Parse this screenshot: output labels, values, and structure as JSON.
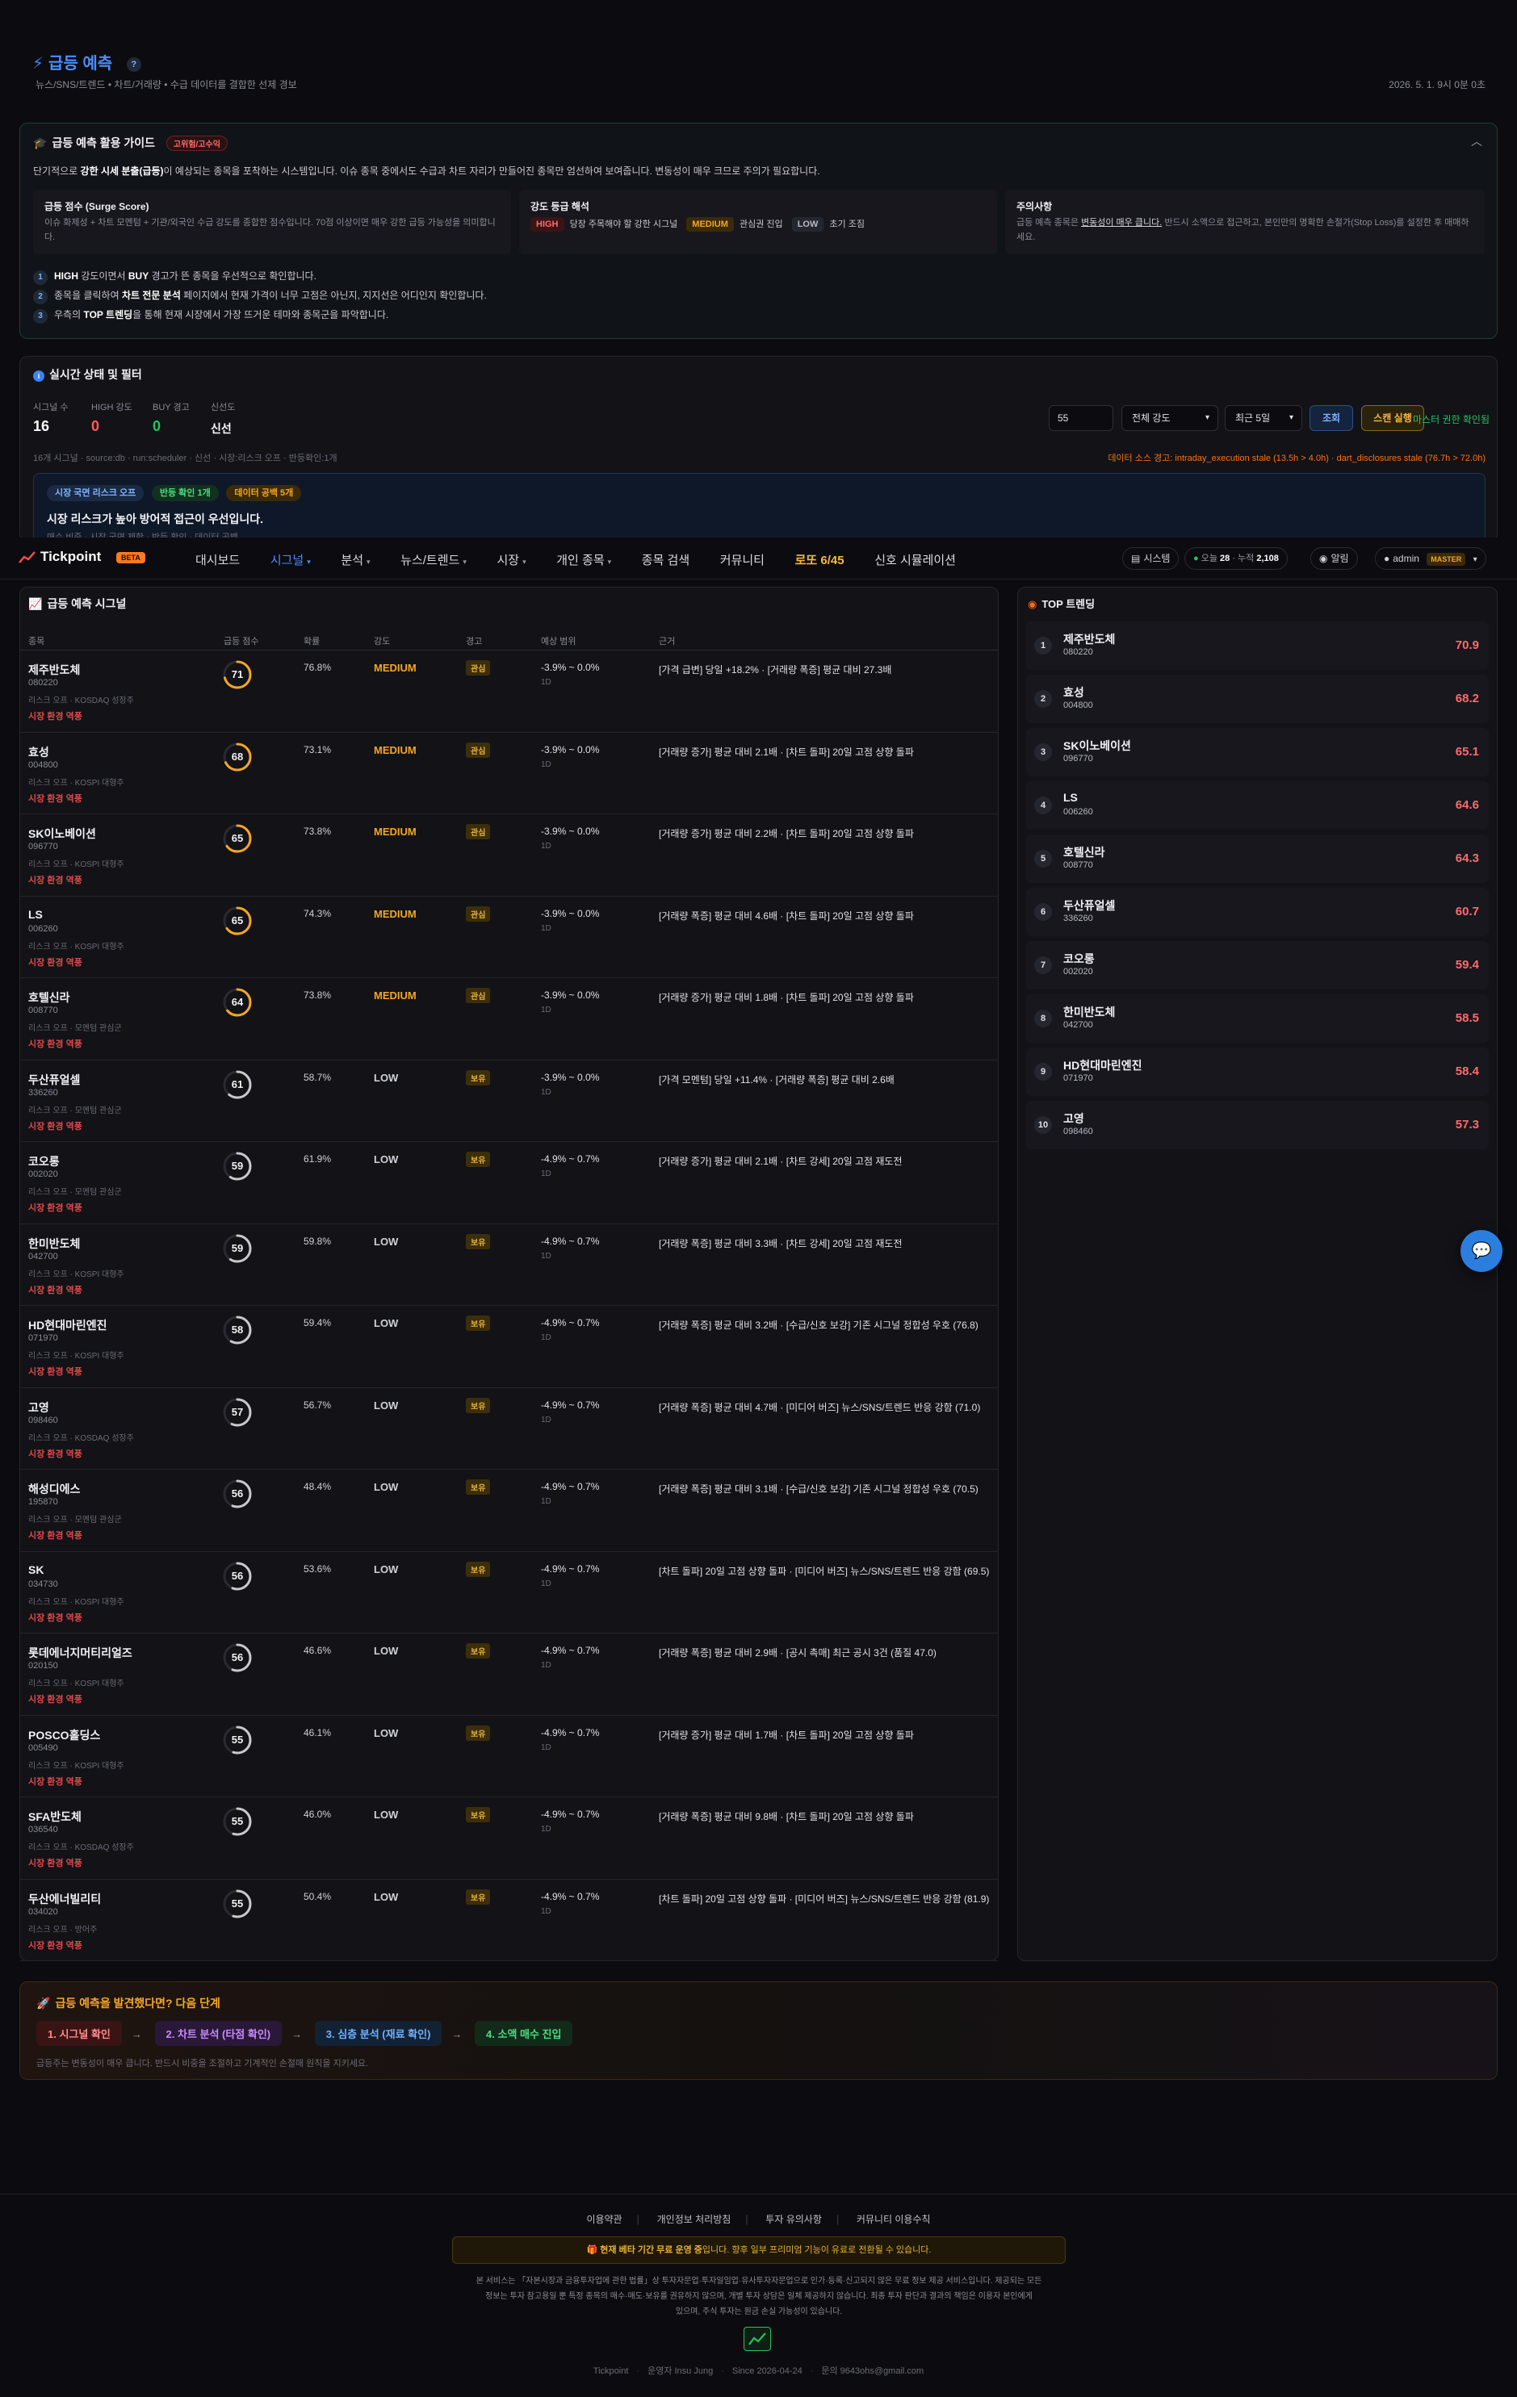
{
  "header": {
    "title": "급등 예측",
    "subtitle": "뉴스/SNS/트렌드 • 차트/거래량 • 수급 데이터를 결합한 선제 경보",
    "datetime": "2026. 5. 1. 9시 0분 0초"
  },
  "guide": {
    "title": "급등 예측 활용 가이드",
    "badge": "고위험/고수익",
    "intro_prefix": "단기적으로 ",
    "intro_bold": "강한 시세 분출(급등)",
    "intro_suffix": "이 예상되는 종목을 포착하는 시스템입니다. 이슈 종목 중에서도 수급과 차트 자리가 만들어진 종목만 엄선하여 보여줍니다. 변동성이 매우 크므로 주의가 필요합니다.",
    "box1_title": "급등 점수 (Surge Score)",
    "box1_text": "이슈 화제성 + 차트 모멘텀 + 기관/외국인 수급 강도를 종합한 점수입니다. 70점 이상이면 매우 강한 급등 가능성을 의미합니다.",
    "box2_title": "강도 등급 해석",
    "box2_high": "HIGH",
    "box2_high_text": "당장 주목해야 할 강한 시그널",
    "box2_med": "MEDIUM",
    "box2_med_text": "관심권 진입",
    "box2_low": "LOW",
    "box2_low_text": "초기 조짐",
    "box3_title": "주의사항",
    "box3_text1": "급등 예측 종목은 ",
    "box3_underline": "변동성이 매우 큽니다.",
    "box3_text2": " 반드시 소액으로 접근하고, 본인만의 명확한 손절가(Stop Loss)를 설정한 후 매매하세요.",
    "tip1_bold1": "HIGH",
    "tip1_mid": " 강도이면서 ",
    "tip1_bold2": "BUY",
    "tip1_end": " 경고가 뜬 종목을 우선적으로 확인합니다.",
    "tip2_start": "종목을 클릭하여 ",
    "tip2_bold": "차트 전문 분석",
    "tip2_end": " 페이지에서 현재 가격이 너무 고점은 아닌지, 지지선은 어디인지 확인합니다.",
    "tip3_start": "우측의 ",
    "tip3_bold": "TOP 트렌딩",
    "tip3_end": "을 통해 현재 시장에서 가장 뜨거운 테마와 종목군을 파악합니다."
  },
  "status": {
    "title": "실시간 상태 및 필터",
    "signal_label": "시그널 수",
    "signal_value": "16",
    "high_label": "HIGH 강도",
    "high_value": "0",
    "buy_label": "BUY 경고",
    "buy_value": "0",
    "fresh_label": "신선도",
    "fresh_value": "신선",
    "meta": "16개 시그널 · source:db · run:scheduler · 신선 · 시장:리스크 오프 · 반등확인:1개",
    "alert": "데이터 소스 경고: intraday_execution stale (13.5h > 4.0h) · dart_disclosures stale (76.7h > 72.0h)",
    "input_value": "55",
    "select_strength": "전체 강도",
    "select_period": "최근 5일",
    "btn_query": "조회",
    "btn_scan": "스캔 실행",
    "master_text": "마스터 권한 확인됨",
    "chip1": "시장 국면 리스크 오프",
    "chip2": "반등 확인 1개",
    "chip3": "데이터 공백 5개",
    "banner_title": "시장 리스크가 높아 방어적 접근이 우선입니다.",
    "banner_sub": "매수 비중 · 시장 국면 제한 · 반등 확인 · 데이터 공백"
  },
  "nav": {
    "logo": "Tickpoint",
    "beta": "BETA",
    "items": [
      "대시보드",
      "시그널",
      "분석",
      "뉴스/트렌드",
      "시장",
      "개인 종목",
      "종목 검색",
      "커뮤니티",
      "로또 6/45",
      "신호 시뮬레이션"
    ],
    "system": "시스템",
    "today_label": "오늘",
    "today_value": "28",
    "total_label": "누적",
    "total_value": "2,108",
    "alarm": "알림",
    "user": "admin",
    "user_role": "MASTER"
  },
  "table": {
    "title": "급등 예측 시그널",
    "headers": [
      "종목",
      "급등 점수",
      "확률",
      "강도",
      "경고",
      "예상 범위",
      "근거"
    ],
    "rows": [
      {
        "name": "제주반도체",
        "code": "080220",
        "risk": "리스크 오프 · KOSDAQ 성장주",
        "env": "시장 환경 역풍",
        "score": 71,
        "prob": "76.8%",
        "strength": "MEDIUM",
        "warn": "관심",
        "range": "-3.9% ~ 0.0%",
        "period": "1D",
        "reason": "[가격 급변] 당일 +18.2% · [거래량 폭증] 평균 대비 27.3배"
      },
      {
        "name": "효성",
        "code": "004800",
        "risk": "리스크 오프 · KOSPI 대형주",
        "env": "시장 환경 역풍",
        "score": 68,
        "prob": "73.1%",
        "strength": "MEDIUM",
        "warn": "관심",
        "range": "-3.9% ~ 0.0%",
        "period": "1D",
        "reason": "[거래량 증가] 평균 대비 2.1배 · [차트 돌파] 20일 고점 상향 돌파"
      },
      {
        "name": "SK이노베이션",
        "code": "096770",
        "risk": "리스크 오프 · KOSPI 대형주",
        "env": "시장 환경 역풍",
        "score": 65,
        "prob": "73.8%",
        "strength": "MEDIUM",
        "warn": "관심",
        "range": "-3.9% ~ 0.0%",
        "period": "1D",
        "reason": "[거래량 증가] 평균 대비 2.2배 · [차트 돌파] 20일 고점 상향 돌파"
      },
      {
        "name": "LS",
        "code": "006260",
        "risk": "리스크 오프 · KOSPI 대형주",
        "env": "시장 환경 역풍",
        "score": 65,
        "prob": "74.3%",
        "strength": "MEDIUM",
        "warn": "관심",
        "range": "-3.9% ~ 0.0%",
        "period": "1D",
        "reason": "[거래량 폭증] 평균 대비 4.6배 · [차트 돌파] 20일 고점 상향 돌파"
      },
      {
        "name": "호텔신라",
        "code": "008770",
        "risk": "리스크 오프 · 모멘텀 관심군",
        "env": "시장 환경 역풍",
        "score": 64,
        "prob": "73.8%",
        "strength": "MEDIUM",
        "warn": "관심",
        "range": "-3.9% ~ 0.0%",
        "period": "1D",
        "reason": "[거래량 증가] 평균 대비 1.8배 · [차트 돌파] 20일 고점 상향 돌파"
      },
      {
        "name": "두산퓨얼셀",
        "code": "336260",
        "risk": "리스크 오프 · 모멘텀 관심군",
        "env": "시장 환경 역풍",
        "score": 61,
        "prob": "58.7%",
        "strength": "LOW",
        "warn": "보유",
        "range": "-3.9% ~ 0.0%",
        "period": "1D",
        "reason": "[가격 모멘텀] 당일 +11.4% · [거래량 폭증] 평균 대비 2.6배"
      },
      {
        "name": "코오롱",
        "code": "002020",
        "risk": "리스크 오프 · 모멘텀 관심군",
        "env": "시장 환경 역풍",
        "score": 59,
        "prob": "61.9%",
        "strength": "LOW",
        "warn": "보유",
        "range": "-4.9% ~ 0.7%",
        "period": "1D",
        "reason": "[거래량 증가] 평균 대비 2.1배 · [차트 강세] 20일 고점 재도전"
      },
      {
        "name": "한미반도체",
        "code": "042700",
        "risk": "리스크 오프 · KOSPI 대형주",
        "env": "시장 환경 역풍",
        "score": 59,
        "prob": "59.8%",
        "strength": "LOW",
        "warn": "보유",
        "range": "-4.9% ~ 0.7%",
        "period": "1D",
        "reason": "[거래량 폭증] 평균 대비 3.3배 · [차트 강세] 20일 고점 재도전"
      },
      {
        "name": "HD현대마린엔진",
        "code": "071970",
        "risk": "리스크 오프 · KOSPI 대형주",
        "env": "시장 환경 역풍",
        "score": 58,
        "prob": "59.4%",
        "strength": "LOW",
        "warn": "보유",
        "range": "-4.9% ~ 0.7%",
        "period": "1D",
        "reason": "[거래량 폭증] 평균 대비 3.2배 · [수급/신호 보강] 기존 시그널 정합성 우호 (76.8)"
      },
      {
        "name": "고영",
        "code": "098460",
        "risk": "리스크 오프 · KOSDAQ 성장주",
        "env": "시장 환경 역풍",
        "score": 57,
        "prob": "56.7%",
        "strength": "LOW",
        "warn": "보유",
        "range": "-4.9% ~ 0.7%",
        "period": "1D",
        "reason": "[거래량 폭증] 평균 대비 4.7배 · [미디어 버즈] 뉴스/SNS/트렌드 반응 강함 (71.0)"
      },
      {
        "name": "해성디에스",
        "code": "195870",
        "risk": "리스크 오프 · 모멘텀 관심군",
        "env": "시장 환경 역풍",
        "score": 56,
        "prob": "48.4%",
        "strength": "LOW",
        "warn": "보유",
        "range": "-4.9% ~ 0.7%",
        "period": "1D",
        "reason": "[거래량 폭증] 평균 대비 3.1배 · [수급/신호 보강] 기존 시그널 정합성 우호 (70.5)"
      },
      {
        "name": "SK",
        "code": "034730",
        "risk": "리스크 오프 · KOSPI 대형주",
        "env": "시장 환경 역풍",
        "score": 56,
        "prob": "53.6%",
        "strength": "LOW",
        "warn": "보유",
        "range": "-4.9% ~ 0.7%",
        "period": "1D",
        "reason": "[차트 돌파] 20일 고점 상향 돌파 · [미디어 버즈] 뉴스/SNS/트렌드 반응 강함 (69.5)"
      },
      {
        "name": "롯데에너지머티리얼즈",
        "code": "020150",
        "risk": "리스크 오프 · KOSPI 대형주",
        "env": "시장 환경 역풍",
        "score": 56,
        "prob": "46.6%",
        "strength": "LOW",
        "warn": "보유",
        "range": "-4.9% ~ 0.7%",
        "period": "1D",
        "reason": "[거래량 폭증] 평균 대비 2.9배 · [공시 촉매] 최근 공시 3건 (품질 47.0)"
      },
      {
        "name": "POSCO홀딩스",
        "code": "005490",
        "risk": "리스크 오프 · KOSPI 대형주",
        "env": "시장 환경 역풍",
        "score": 55,
        "prob": "46.1%",
        "strength": "LOW",
        "warn": "보유",
        "range": "-4.9% ~ 0.7%",
        "period": "1D",
        "reason": "[거래량 증가] 평균 대비 1.7배 · [차트 돌파] 20일 고점 상향 돌파"
      },
      {
        "name": "SFA반도체",
        "code": "036540",
        "risk": "리스크 오프 · KOSDAQ 성장주",
        "env": "시장 환경 역풍",
        "score": 55,
        "prob": "46.0%",
        "strength": "LOW",
        "warn": "보유",
        "range": "-4.9% ~ 0.7%",
        "period": "1D",
        "reason": "[거래량 폭증] 평균 대비 9.8배 · [차트 돌파] 20일 고점 상향 돌파"
      },
      {
        "name": "두산에너빌리티",
        "code": "034020",
        "risk": "리스크 오프 · 방어주",
        "env": "시장 환경 역풍",
        "score": 55,
        "prob": "50.4%",
        "strength": "LOW",
        "warn": "보유",
        "range": "-4.9% ~ 0.7%",
        "period": "1D",
        "reason": "[차트 돌파] 20일 고점 상향 돌파 · [미디어 버즈] 뉴스/SNS/트렌드 반응 강함 (81.9)"
      }
    ]
  },
  "trending": {
    "title": "TOP 트렌딩",
    "items": [
      {
        "rank": "1",
        "name": "제주반도체",
        "code": "080220",
        "score": "70.9"
      },
      {
        "rank": "2",
        "name": "효성",
        "code": "004800",
        "score": "68.2"
      },
      {
        "rank": "3",
        "name": "SK이노베이션",
        "code": "096770",
        "score": "65.1"
      },
      {
        "rank": "4",
        "name": "LS",
        "code": "006260",
        "score": "64.6"
      },
      {
        "rank": "5",
        "name": "호텔신라",
        "code": "008770",
        "score": "64.3"
      },
      {
        "rank": "6",
        "name": "두산퓨얼셀",
        "code": "336260",
        "score": "60.7"
      },
      {
        "rank": "7",
        "name": "코오롱",
        "code": "002020",
        "score": "59.4"
      },
      {
        "rank": "8",
        "name": "한미반도체",
        "code": "042700",
        "score": "58.5"
      },
      {
        "rank": "9",
        "name": "HD현대마린엔진",
        "code": "071970",
        "score": "58.4"
      },
      {
        "rank": "10",
        "name": "고영",
        "code": "098460",
        "score": "57.3"
      }
    ]
  },
  "next": {
    "title": "급등 예측을 발견했다면? 다음 단계",
    "steps": [
      "1. 시그널 확인",
      "2. 차트 분석 (타점 확인)",
      "3. 심층 분석 (재료 확인)",
      "4. 소액 매수 진입"
    ],
    "note": "급등주는 변동성이 매우 큽니다. 반드시 비중을 조절하고 기계적인 손절매 원칙을 지키세요."
  },
  "footer": {
    "links": [
      "이용약관",
      "개인정보 처리방침",
      "투자 유의사항",
      "커뮤니티 이용수칙"
    ],
    "beta_notice_bold": "현재 베타 기간 무료 운영 중",
    "beta_notice_rest": "입니다. 향후 일부 프리미엄 기능이 유료로 전환될 수 있습니다.",
    "disclaimer1": "본 서비스는 「자본시장과 금융투자업에 관한 법률」상 투자자문업·투자일임업·유사투자자문업으로 인가·등록·신고되지 않은 무료 정보 제공 서비스입니다. 제공되는 모든",
    "disclaimer2": "정보는 투자 참고용일 뿐 특정 종목의 매수·매도·보유를 권유하지 않으며, 개별 투자 상담은 일체 제공하지 않습니다. 최종 투자 판단과 결과의 책임은 이용자 본인에게",
    "disclaimer3": "있으며, 주식 투자는 원금 손실 가능성이 있습니다.",
    "brand": "Tickpoint",
    "operator": "운영자 Insu Jung",
    "since": "Since 2026-04-24",
    "contact": "문의 9643ohs@gmail.com"
  },
  "colors": {
    "accent_blue": "#3b82f6",
    "high_red": "#ff5c5c",
    "medium_orange": "#f5a623",
    "buy_green": "#22c55e",
    "trend_score": "#ff6b6b"
  }
}
